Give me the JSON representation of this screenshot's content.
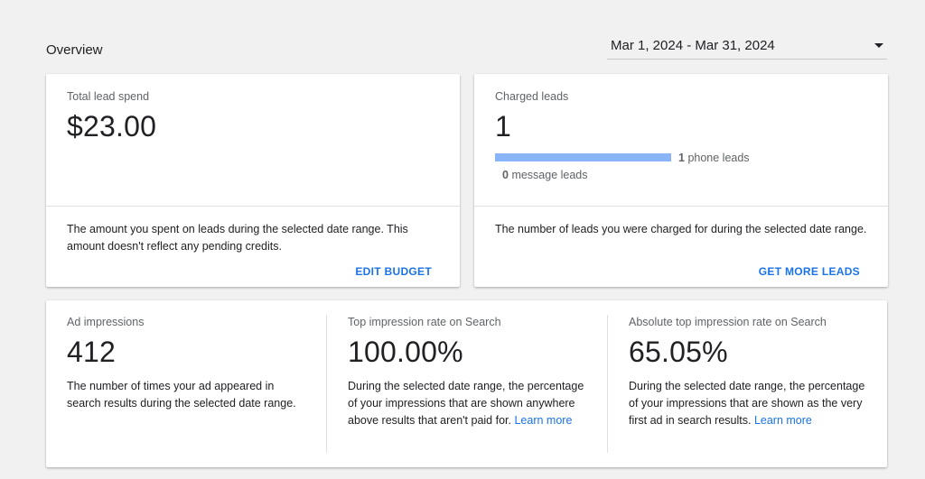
{
  "overview": {
    "title": "Overview",
    "date_range": "Mar 1, 2024 - Mar 31, 2024"
  },
  "lead_spend": {
    "label": "Total lead spend",
    "value": "$23.00",
    "description": "The amount you spent on leads during the selected date range. This amount doesn't reflect any pending credits.",
    "action": "EDIT BUDGET"
  },
  "charged_leads": {
    "label": "Charged leads",
    "value": "1",
    "phone_count": "1",
    "phone_label": "phone leads",
    "phone_share": 1.0,
    "message_count": "0",
    "message_label": "message leads",
    "message_share": 0.0,
    "description": "The number of leads you were charged for during the selected date range.",
    "action": "GET MORE LEADS"
  },
  "impressions": [
    {
      "label": "Ad impressions",
      "value": "412",
      "description": "The number of times your ad appeared in search results during the selected date range.",
      "link": ""
    },
    {
      "label": "Top impression rate on Search",
      "value": "100.00%",
      "description": "During the selected date range, the percentage of your impressions that are shown anywhere above results that aren't paid for.",
      "link": "Learn more"
    },
    {
      "label": "Absolute top impression rate on Search",
      "value": "65.05%",
      "description": "During the selected date range, the percentage of your impressions that are shown as the very first ad in search results.",
      "link": "Learn more"
    }
  ],
  "colors": {
    "accent": "#1a73e8",
    "bar": "#8ab4f8",
    "background": "#f1f1f1"
  }
}
